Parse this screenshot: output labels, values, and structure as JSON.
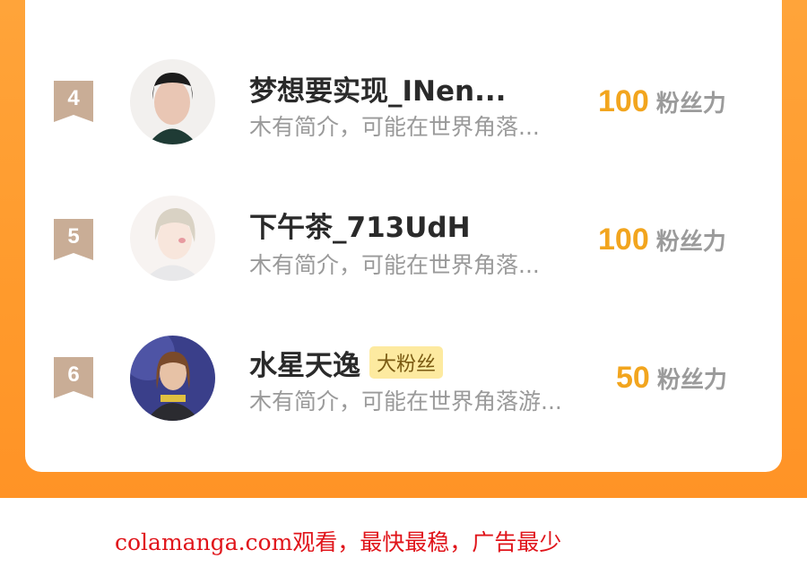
{
  "ranking": {
    "rows": [
      {
        "rank": "4",
        "name": "梦想要实现_INen...",
        "badge": "",
        "bio": "木有简介，可能在世界角落...",
        "score": "100",
        "unit": "粉丝力"
      },
      {
        "rank": "5",
        "name": "下午茶_713UdH",
        "badge": "",
        "bio": "木有简介，可能在世界角落...",
        "score": "100",
        "unit": "粉丝力"
      },
      {
        "rank": "6",
        "name": "水星天逸",
        "badge": "大粉丝",
        "bio": "木有简介，可能在世界角落游...",
        "score": "50",
        "unit": "粉丝力"
      }
    ]
  },
  "footer": {
    "text": "colamanga.com观看，最快最稳，广告最少"
  },
  "colors": {
    "orange": "#ff9a2c",
    "score": "#f2a51e",
    "rank_badge": "#c9ad96"
  }
}
